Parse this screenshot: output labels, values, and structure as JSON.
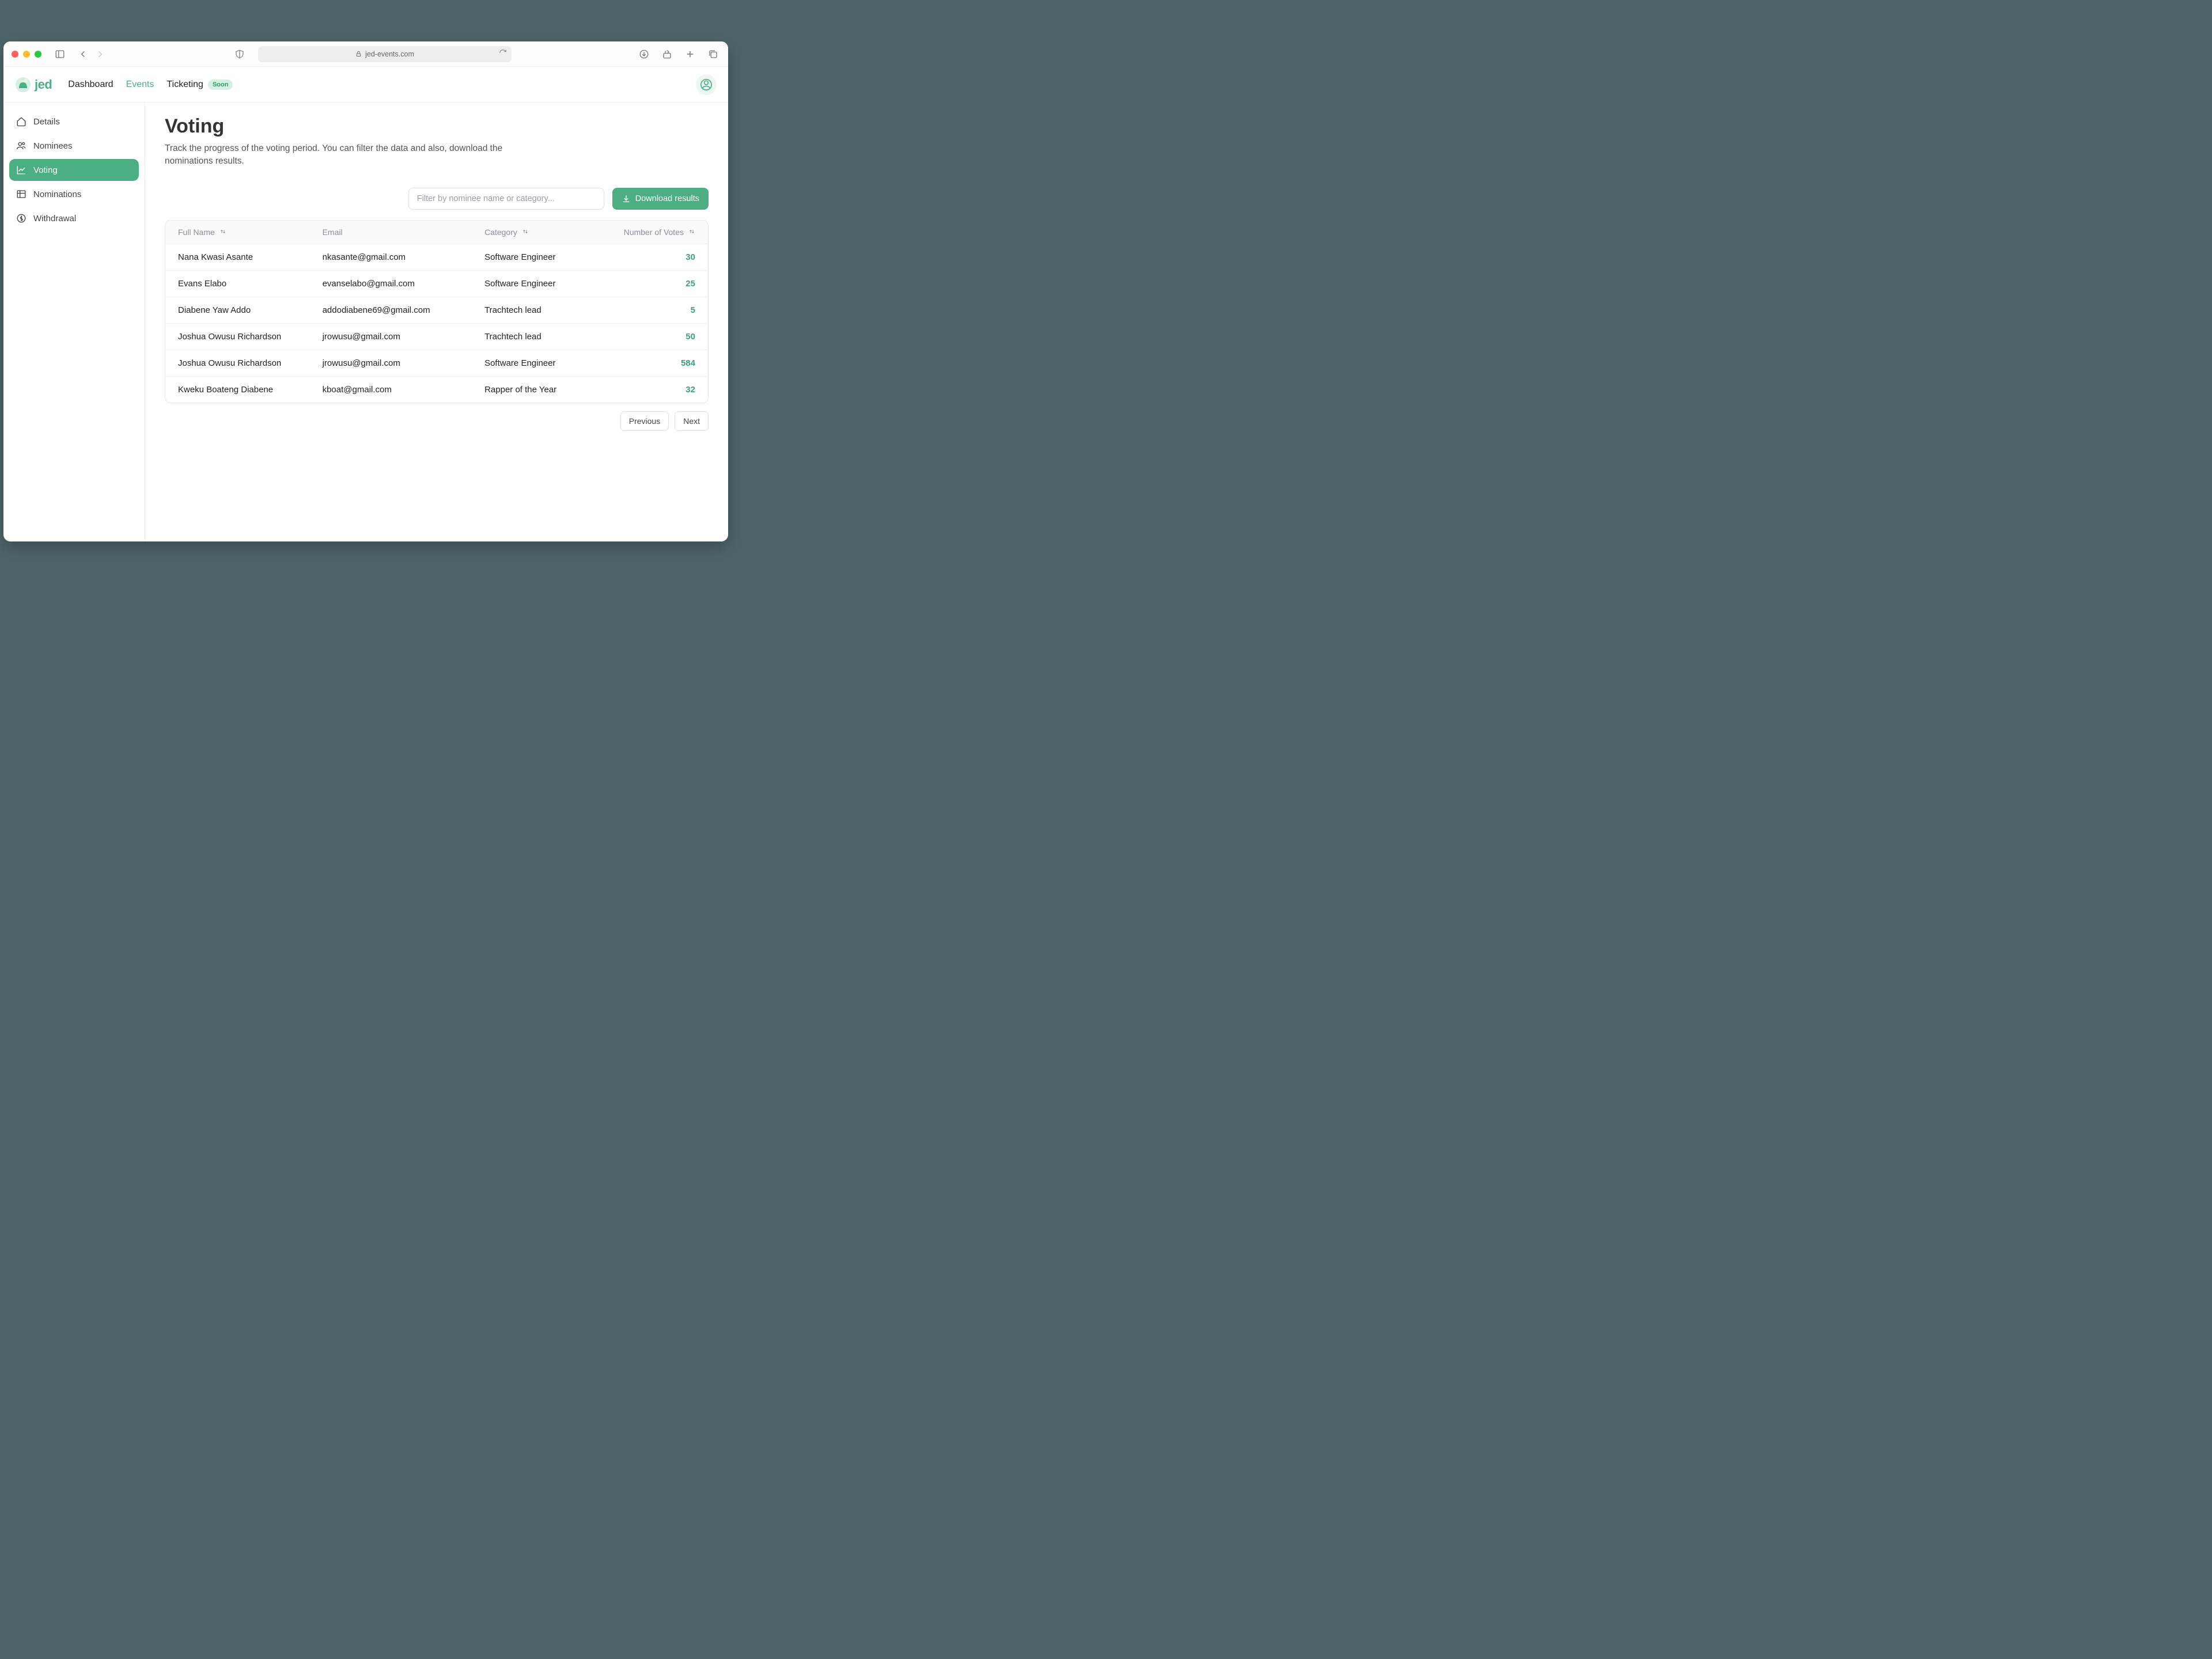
{
  "browser": {
    "url": "jed-events.com"
  },
  "brand": "jed",
  "topnav": {
    "dashboard": "Dashboard",
    "events": "Events",
    "ticketing": "Ticketing",
    "ticketing_badge": "Soon"
  },
  "sidebar": {
    "items": [
      {
        "label": "Details"
      },
      {
        "label": "Nominees"
      },
      {
        "label": "Voting"
      },
      {
        "label": "Nominations"
      },
      {
        "label": "Withdrawal"
      }
    ]
  },
  "page": {
    "title": "Voting",
    "description": "Track the progress of the voting period. You can filter the data and also, download the nominations results."
  },
  "toolbar": {
    "filter_placeholder": "Filter by nominee name or category...",
    "download_label": "Download results"
  },
  "table": {
    "columns": {
      "full_name": "Full Name",
      "email": "Email",
      "category": "Category",
      "votes": "Number of Votes"
    },
    "rows": [
      {
        "full_name": "Nana Kwasi Asante",
        "email": "nkasante@gmail.com",
        "category": "Software Engineer",
        "votes": "30"
      },
      {
        "full_name": "Evans Elabo",
        "email": "evanselabo@gmail.com",
        "category": "Software Engineer",
        "votes": "25"
      },
      {
        "full_name": "Diabene Yaw Addo",
        "email": "addodiabene69@gmail.com",
        "category": "Trachtech lead",
        "votes": "5"
      },
      {
        "full_name": "Joshua Owusu Richardson",
        "email": "jrowusu@gmail.com",
        "category": "Trachtech lead",
        "votes": "50"
      },
      {
        "full_name": "Joshua Owusu Richardson",
        "email": "jrowusu@gmail.com",
        "category": "Software Engineer",
        "votes": "584"
      },
      {
        "full_name": "Kweku Boateng Diabene",
        "email": "kboat@gmail.com",
        "category": "Rapper of the Year",
        "votes": "32"
      }
    ]
  },
  "pagination": {
    "previous": "Previous",
    "next": "Next"
  },
  "colors": {
    "accent": "#4caf84"
  }
}
